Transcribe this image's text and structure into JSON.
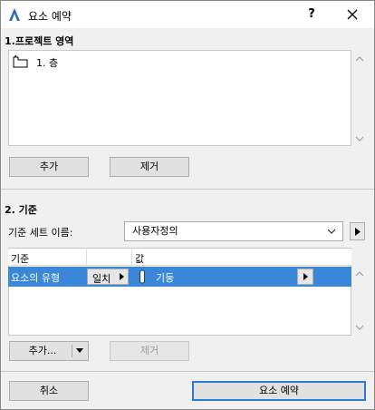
{
  "window": {
    "title": "요소 예약",
    "help_label": "?"
  },
  "project_area": {
    "section_label": "1.프로젝트 영역",
    "items": [
      {
        "label": "1. 층",
        "icon": "floor-icon"
      }
    ],
    "add_label": "추가",
    "remove_label": "제거"
  },
  "criteria": {
    "section_label": "2. 기준",
    "set_name_label": "기준 세트 이름:",
    "set_name_value": "사용자정의",
    "table": {
      "col_criterion": "기준",
      "col_value": "값",
      "rows": [
        {
          "criterion": "요소의 유형",
          "operator": "일치",
          "value": "기둥",
          "value_icon": "column-icon"
        }
      ]
    },
    "add_label": "추가...",
    "remove_label": "제거"
  },
  "footer": {
    "cancel_label": "취소",
    "reserve_label": "요소 예약"
  },
  "colors": {
    "selection": "#3a86d9",
    "default_button_border": "#2b7ad6"
  }
}
